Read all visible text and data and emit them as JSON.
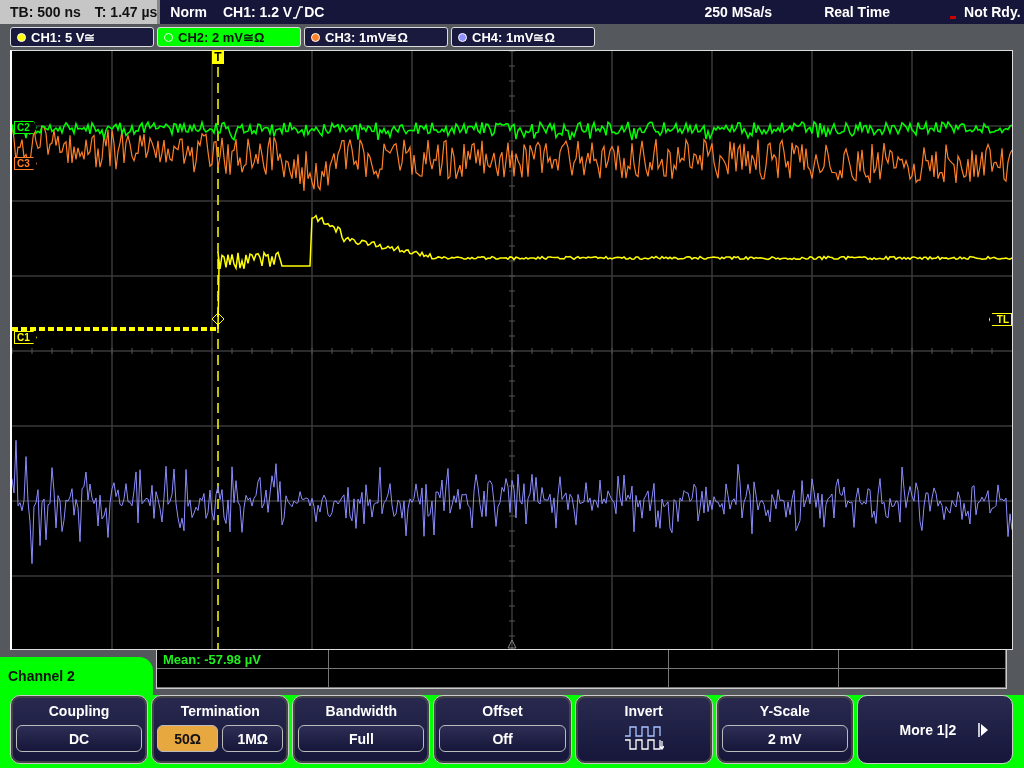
{
  "status_bar": {
    "timebase": "TB: 500 ns",
    "trigger_time": "T: 1.47 µs",
    "mode": "Norm",
    "trigger_source": "CH1: 1.2 V",
    "trigger_coupling": "DC",
    "sample_rate": "250 MSa/s",
    "acquisition": "Real Time",
    "state": "Not Rdy."
  },
  "channel_tabs": [
    {
      "label": "CH1: 5 V≅",
      "color": "#ffff00",
      "selected": false
    },
    {
      "label": "CH2: 2 mV≅Ω",
      "color": "#00ff00",
      "selected": true
    },
    {
      "label": "CH3: 1mV≅Ω",
      "color": "#ff7f27",
      "selected": false
    },
    {
      "label": "CH4: 1mV≅Ω",
      "color": "#9090ff",
      "selected": false
    }
  ],
  "markers": [
    {
      "kind": "channel",
      "label": "C2",
      "color": "#00ff00"
    },
    {
      "kind": "channel",
      "label": "C3",
      "color": "#ff7f27"
    },
    {
      "kind": "channel",
      "label": "C1",
      "color": "#ffff00"
    },
    {
      "kind": "level",
      "label": "TL",
      "color": "#ffff00"
    },
    {
      "kind": "trigger",
      "label": "T",
      "color": "#ffff00"
    }
  ],
  "measurement": {
    "text": "Mean: -57.98 µV"
  },
  "menu": {
    "title": "Channel 2",
    "buttons": [
      {
        "kind": "value",
        "title": "Coupling",
        "value": "DC"
      },
      {
        "kind": "choice",
        "title": "Termination",
        "options": [
          {
            "label": "50Ω",
            "selected": true
          },
          {
            "label": "1MΩ",
            "selected": false
          }
        ]
      },
      {
        "kind": "value",
        "title": "Bandwidth",
        "value": "Full"
      },
      {
        "kind": "value",
        "title": "Offset",
        "value": "Off"
      },
      {
        "kind": "icon",
        "title": "Invert"
      },
      {
        "kind": "value",
        "title": "Y-Scale",
        "value": "2 mV"
      },
      {
        "kind": "more",
        "title": "More 1|2"
      }
    ]
  }
}
